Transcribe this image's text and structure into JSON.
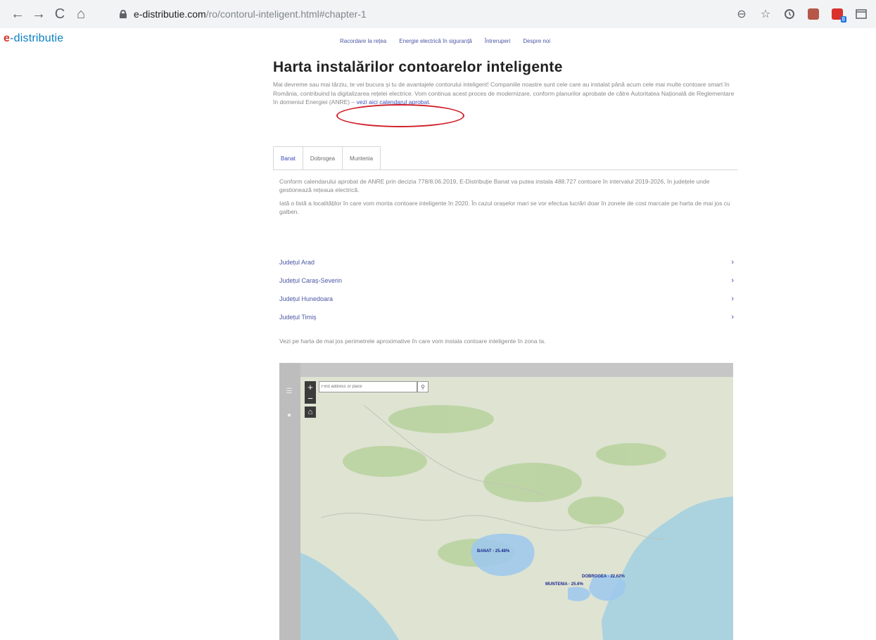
{
  "browser": {
    "url_domain": "e-distributie.com",
    "url_path": "/ro/contorul-inteligent.html#chapter-1",
    "back_glyph": "←",
    "forward_glyph": "→",
    "reload_glyph": "C",
    "home_glyph": "⌂",
    "zoom_glyph": "⊖",
    "star_glyph": "☆",
    "ext_badge": "8"
  },
  "site": {
    "logo_e": "e",
    "logo_rest": "-distributie",
    "nav": [
      "Racordare la rețea",
      "Energie electrică în siguranță",
      "Întreruperi",
      "Despre noi"
    ]
  },
  "main": {
    "title": "Harta instalărilor contoarelor inteligente",
    "intro_text": "Mai devreme sau mai târziu, te vei bucura și tu de avantajele contorului inteligent! Companiile noastre sunt cele care au instalat până acum cele mai multe contoare smart în România, contribuind la digitalizarea rețelei electrice. Vom continua acest proces de modernizare, conform planurilor aprobate de către Autoritatea Națională de Reglementare în domeniul Energiei (ANRE) –",
    "intro_link": "vezi aici calendarul aprobat.",
    "tabs": [
      "Banat",
      "Dobrogea",
      "Muntenia"
    ],
    "tab_paragraph_1": "Conform calendarului aprobat de ANRE prin decizia 778/8.06.2019, E-Distribuție Banat va putea instala 488.727 contoare în intervalul 2019-2026, în județele unde gestionează rețeaua electrică.",
    "tab_paragraph_2": "Iată o listă a localităților în care vom monta contoare inteligente în 2020. În cazul orașelor mari se vor efectua lucrări doar în zonele de cost marcate pe harta de mai jos cu galben.",
    "counties": [
      "Județul Arad",
      "Județul Caraș-Severin",
      "Județul Hunedoara",
      "Județul Timiș"
    ],
    "chevron": "›",
    "map_caption": "Vezi pe harta de mai jos perimetrele aproximative în care vom instala contoare inteligente în zona ta."
  },
  "map": {
    "search_placeholder": "Find address or place",
    "zoom_in": "+",
    "zoom_out": "−",
    "search_glyph": "⚲",
    "home_glyph": "⌂",
    "menu_glyph": "☰",
    "info_glyph": "●",
    "labels": {
      "banat": "BANAT - 25.48%",
      "dobrogea": "DOBROGEA - 22.62%",
      "muntenia": "MUNTENIA - 25.6%"
    },
    "colors": {
      "sea": "#aad3df",
      "land": "#dfe3d2",
      "forest": "#b9d3a0",
      "region_fill": "#9ec8ee",
      "region_label": "#1c2a8f"
    }
  },
  "colors": {
    "accent_link": "#3d4fb7",
    "highlight_ellipse": "#d01f2a",
    "logo_blue": "#0a7fc2",
    "logo_red": "#d7322b"
  }
}
